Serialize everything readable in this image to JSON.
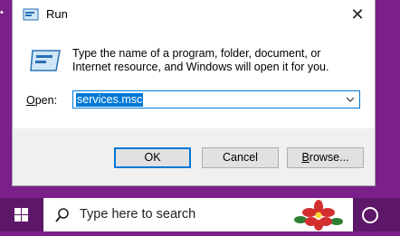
{
  "dialog": {
    "title": "Run",
    "description": "Type the name of a program, folder, document, or Internet resource, and Windows will open it for you.",
    "open_label_prefix": "",
    "open_label_underlined": "O",
    "open_label_rest": "pen:",
    "open_value": "services.msc",
    "ok_label": "OK",
    "cancel_label": "Cancel",
    "browse_label_prefix": "",
    "browse_label_underlined": "B",
    "browse_label_rest": "rowse..."
  },
  "taskbar": {
    "search_placeholder": "Type here to search"
  },
  "icons": {
    "close": "close-icon",
    "run": "run-icon",
    "start": "windows-logo-icon",
    "search": "search-icon",
    "cortana": "cortana-icon"
  },
  "colors": {
    "accent": "#0078d7",
    "desktop": "#7b1f8a",
    "taskbar": "#5c1768"
  }
}
